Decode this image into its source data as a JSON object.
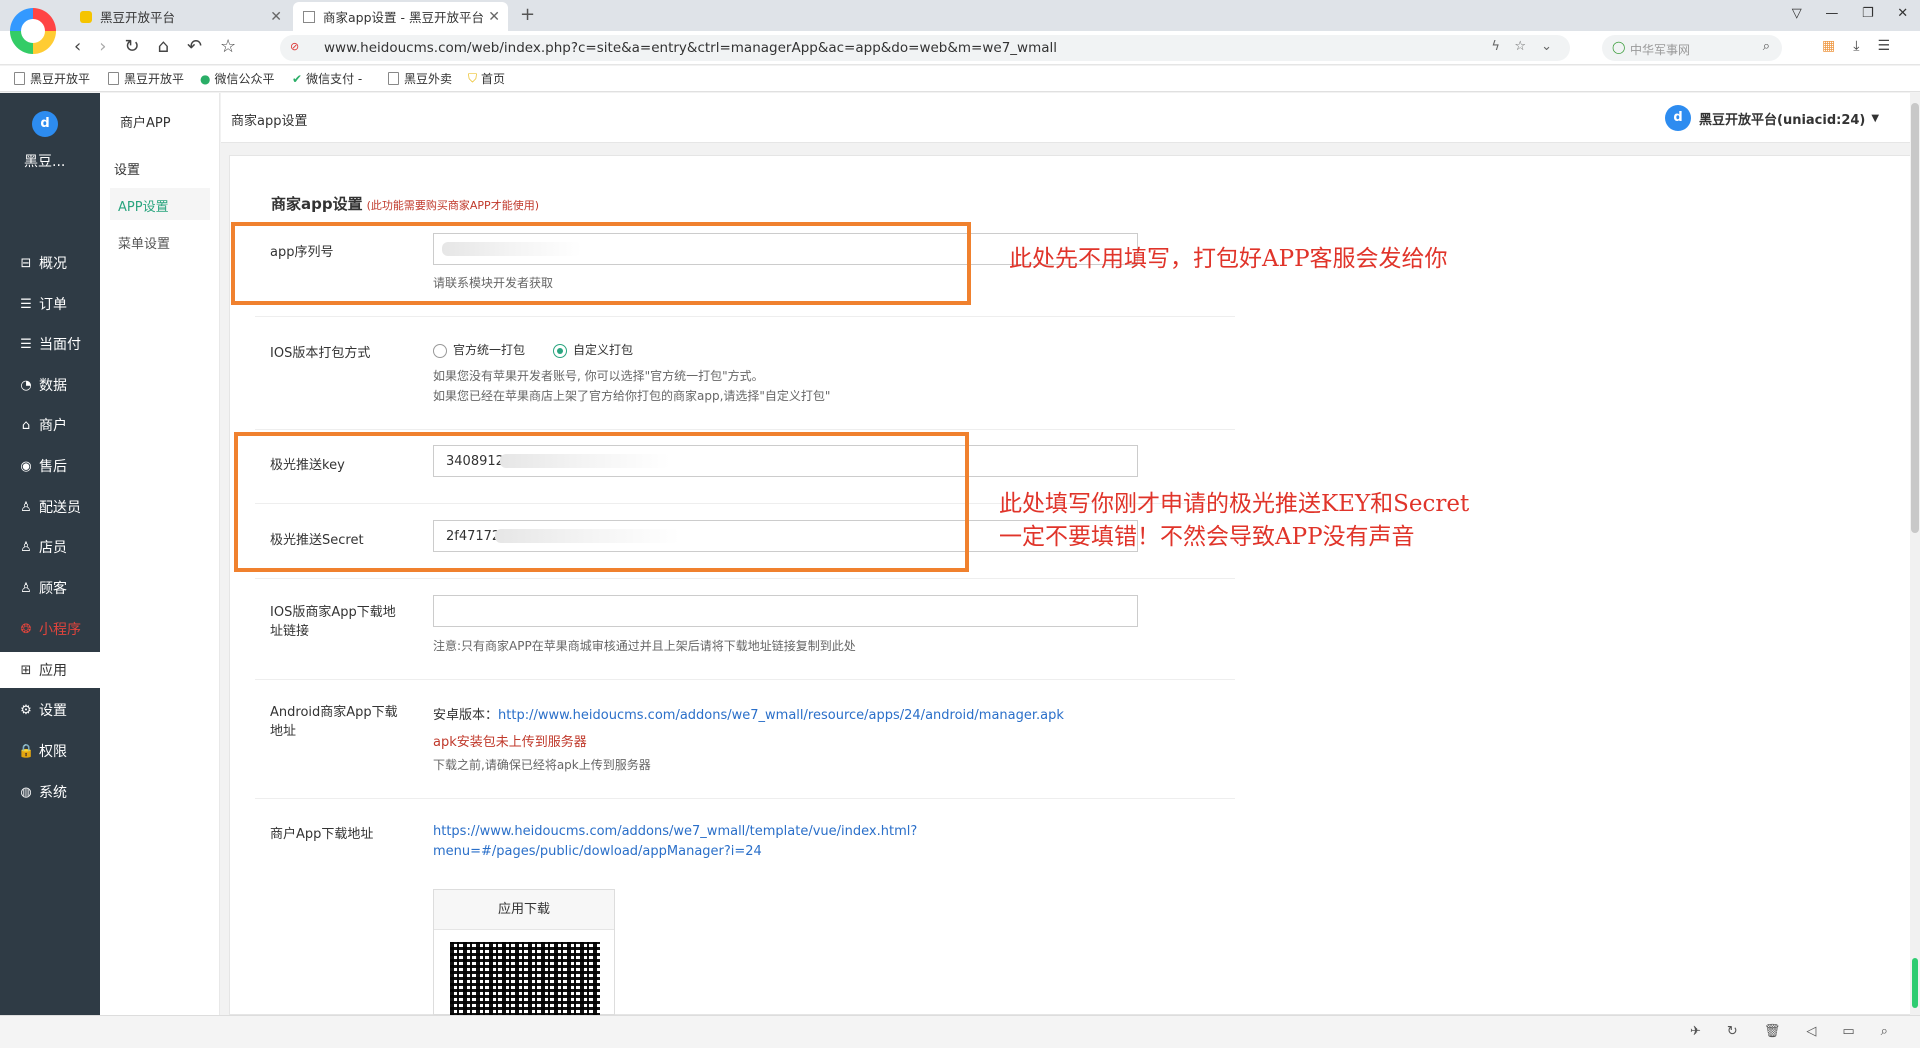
{
  "browser": {
    "tabs": [
      {
        "title": "黑豆开放平台"
      },
      {
        "title": "商家app设置 - 黑豆开放平台"
      }
    ],
    "url": "www.heidoucms.com/web/index.php?c=site&a=entry&ctrl=managerApp&ac=app&do=web&m=we7_wmall",
    "search_placeholder": "中华军事网",
    "bookmarks": [
      "黑豆开放平",
      "黑豆开放平",
      "微信公众平",
      "微信支付 -",
      "黑豆外卖",
      "首页"
    ]
  },
  "sidebar": {
    "brand": "黑豆...",
    "items": [
      {
        "label": "概况",
        "icon": "overview-icon",
        "glyph": "⊟"
      },
      {
        "label": "订单",
        "icon": "order-icon",
        "glyph": "☰"
      },
      {
        "label": "当面付",
        "icon": "pay-icon",
        "glyph": "☰"
      },
      {
        "label": "数据",
        "icon": "data-icon",
        "glyph": "◔"
      },
      {
        "label": "商户",
        "icon": "store-icon",
        "glyph": "⌂"
      },
      {
        "label": "售后",
        "icon": "aftersale-icon",
        "glyph": "◉"
      },
      {
        "label": "配送员",
        "icon": "courier-icon",
        "glyph": "♙"
      },
      {
        "label": "店员",
        "icon": "clerk-icon",
        "glyph": "♙"
      },
      {
        "label": "顾客",
        "icon": "customer-icon",
        "glyph": "♙"
      },
      {
        "label": "小程序",
        "icon": "miniprogram-icon",
        "glyph": "❂"
      },
      {
        "label": "应用",
        "icon": "app-icon",
        "glyph": "⊞"
      },
      {
        "label": "设置",
        "icon": "settings-icon",
        "glyph": "⚙"
      },
      {
        "label": "权限",
        "icon": "lock-icon",
        "glyph": "🔒"
      },
      {
        "label": "系统",
        "icon": "system-icon",
        "glyph": "◍"
      }
    ]
  },
  "subnav": {
    "title": "商户APP",
    "group": "设置",
    "items": [
      "APP设置",
      "菜单设置"
    ]
  },
  "topbar": {
    "breadcrumb": "商家app设置",
    "account": "黑豆开放平台(uniacid:24)"
  },
  "form": {
    "heading": "商家app设置",
    "heading_note": "(此功能需要购买商家APP才能使用)",
    "app_serial": {
      "label": "app序列号",
      "help": "请联系模块开发者获取"
    },
    "ios_pack": {
      "label": "IOS版本打包方式",
      "options": [
        "官方统一打包",
        "自定义打包"
      ],
      "help1": "如果您没有苹果开发者账号, 你可以选择\"官方统一打包\"方式。",
      "help2": "如果您已经在苹果商店上架了官方给你打包的商家app,请选择\"自定义打包\""
    },
    "jpush_key": {
      "label": "极光推送key",
      "value": "3408912"
    },
    "jpush_secret": {
      "label": "极光推送Secret",
      "value": "2f47172"
    },
    "ios_download": {
      "label": "IOS版商家App下载地址链接",
      "help": "注意:只有商家APP在苹果商城审核通过并且上架后请将下载地址链接复制到此处"
    },
    "android_download": {
      "label": "Android商家App下载地址",
      "prefix": "安卓版本：",
      "url": "http://www.heidoucms.com/addons/we7_wmall/resource/apps/24/android/manager.apk",
      "warning": "apk安装包未上传到服务器",
      "help": "下载之前,请确保已经将apk上传到服务器"
    },
    "merchant_download": {
      "label": "商户App下载地址",
      "url_line1": "https://www.heidoucms.com/addons/we7_wmall/template/vue/index.html?",
      "url_line2": "menu=#/pages/public/dowload/appManager?i=24",
      "qr_title": "应用下载"
    }
  },
  "annotations": {
    "note1": "此处先不用填写，打包好APP客服会发给你",
    "note2_line1": "此处填写你刚才申请的极光推送KEY和Secret",
    "note2_line2": "一定不要填错！不然会导致APP没有声音"
  },
  "colors": {
    "sidebar_bg": "#2f3b45",
    "accent": "#2aa57f",
    "annotation": "#f0812e",
    "note_text": "#e0342a"
  }
}
